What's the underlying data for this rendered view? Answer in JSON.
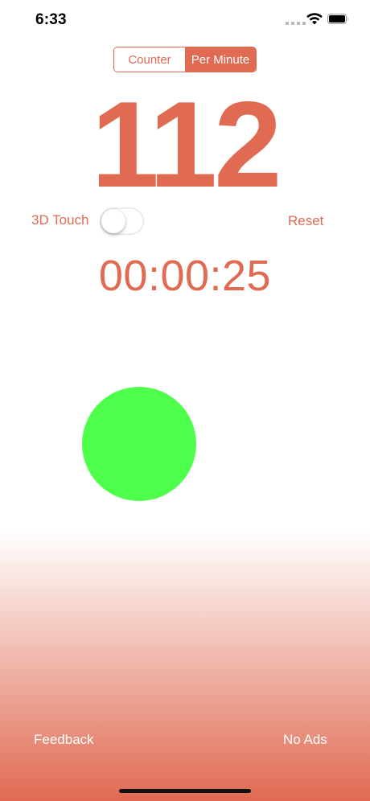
{
  "status_bar": {
    "time": "6:33",
    "wifi_icon": "wifi-icon",
    "battery_icon": "battery-icon"
  },
  "segmented_control": {
    "options": [
      "Counter",
      "Per Minute"
    ],
    "selected": "Per Minute"
  },
  "counter": {
    "value": "112"
  },
  "controls": {
    "touch_label": "3D Touch",
    "touch_enabled": false,
    "reset_label": "Reset"
  },
  "timer": {
    "value": "00:00:25"
  },
  "tap_button": {
    "color": "#4dff4a"
  },
  "footer": {
    "feedback_label": "Feedback",
    "no_ads_label": "No Ads"
  },
  "colors": {
    "accent": "#e06a52",
    "tap": "#4dff4a"
  }
}
